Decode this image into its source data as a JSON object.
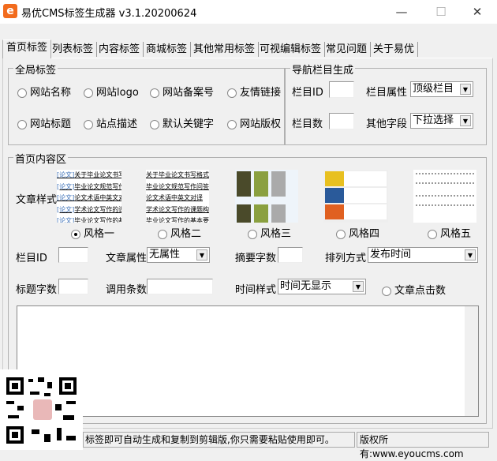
{
  "window": {
    "title": "易优CMS标签生成器 v3.1.20200624",
    "logo": "e",
    "minimize": "—",
    "maximize": "☐",
    "close": "✕"
  },
  "tabs": [
    "首页标签",
    "列表标签",
    "内容标签",
    "商城标签",
    "其他常用标签",
    "可视编辑标签",
    "常见问题",
    "关于易优"
  ],
  "global": {
    "title": "全局标签",
    "options": [
      "网站名称",
      "网站logo",
      "网站备案号",
      "友情链接",
      "网站标题",
      "站点描述",
      "默认关键字",
      "网站版权"
    ]
  },
  "nav": {
    "title": "导航栏目生成",
    "id_label": "栏目ID",
    "attr_label": "栏目属性",
    "attr_value": "顶级栏目",
    "count_label": "栏目数",
    "field_label": "其他字段",
    "field_value": "下拉选择"
  },
  "content": {
    "title": "首页内容区",
    "style_label": "文章样式",
    "styles": [
      "风格一",
      "风格二",
      "风格三",
      "风格四",
      "风格五"
    ],
    "selected_style": 0,
    "preview_tag": "[论文]",
    "preview_items": [
      "关于毕业论文书写格式",
      "毕业论文规范写作问答",
      "论文术语中英文对译",
      "学术论文写作的课题构思",
      "毕业论文写作的基本要求"
    ],
    "id_label": "栏目ID",
    "attr_label": "文章属性",
    "attr_value": "无属性",
    "summary_label": "摘要字数",
    "order_label": "排列方式",
    "order_value": "发布时间",
    "title_len_label": "标题字数",
    "count_label": "调用条数",
    "time_label": "时间样式",
    "time_value": "时间无显示",
    "clicks_label": "文章点击数"
  },
  "status": {
    "message": "标签即可自动生成和复制到剪辑版,你只需要粘贴使用即可。",
    "copyright": "版权所有:www.eyoucms.com"
  }
}
